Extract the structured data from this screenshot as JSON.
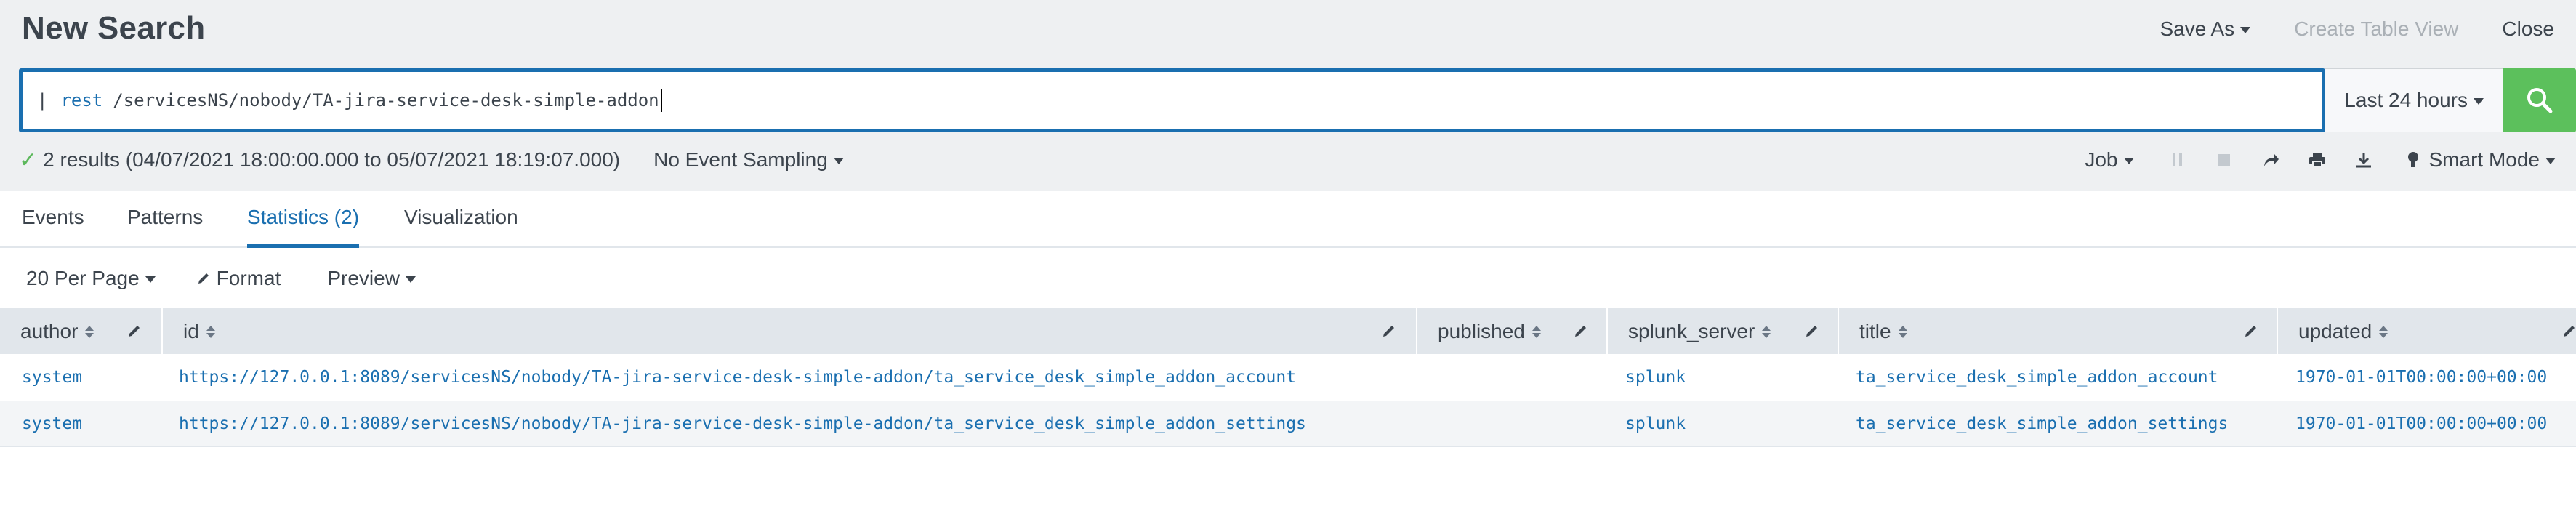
{
  "header": {
    "title": "New Search",
    "save_as": "Save As",
    "create_table_view": "Create Table View",
    "close": "Close"
  },
  "search": {
    "pipe": "|",
    "command": "rest",
    "argument": "/servicesNS/nobody/TA-jira-service-desk-simple-addon",
    "time_range": "Last 24 hours"
  },
  "status": {
    "results": "2 results (04/07/2021 18:00:00.000 to 05/07/2021 18:19:07.000)",
    "sampling": "No Event Sampling",
    "job": "Job",
    "mode": "Smart Mode"
  },
  "tabs": [
    {
      "label": "Events"
    },
    {
      "label": "Patterns"
    },
    {
      "label": "Statistics (2)"
    },
    {
      "label": "Visualization"
    }
  ],
  "toolbar": {
    "per_page": "20 Per Page",
    "format": "Format",
    "preview": "Preview"
  },
  "table": {
    "columns": [
      "author",
      "id",
      "published",
      "splunk_server",
      "title",
      "updated"
    ],
    "rows": [
      {
        "author": "system",
        "id": "https://127.0.0.1:8089/servicesNS/nobody/TA-jira-service-desk-simple-addon/ta_service_desk_simple_addon_account",
        "published": "",
        "splunk_server": "splunk",
        "title": "ta_service_desk_simple_addon_account",
        "updated": "1970-01-01T00:00:00+00:00"
      },
      {
        "author": "system",
        "id": "https://127.0.0.1:8089/servicesNS/nobody/TA-jira-service-desk-simple-addon/ta_service_desk_simple_addon_settings",
        "published": "",
        "splunk_server": "splunk",
        "title": "ta_service_desk_simple_addon_settings",
        "updated": "1970-01-01T00:00:00+00:00"
      }
    ]
  },
  "colors": {
    "accent": "#1a6fb0",
    "search_button": "#5cc05c",
    "success": "#5cb85c"
  }
}
